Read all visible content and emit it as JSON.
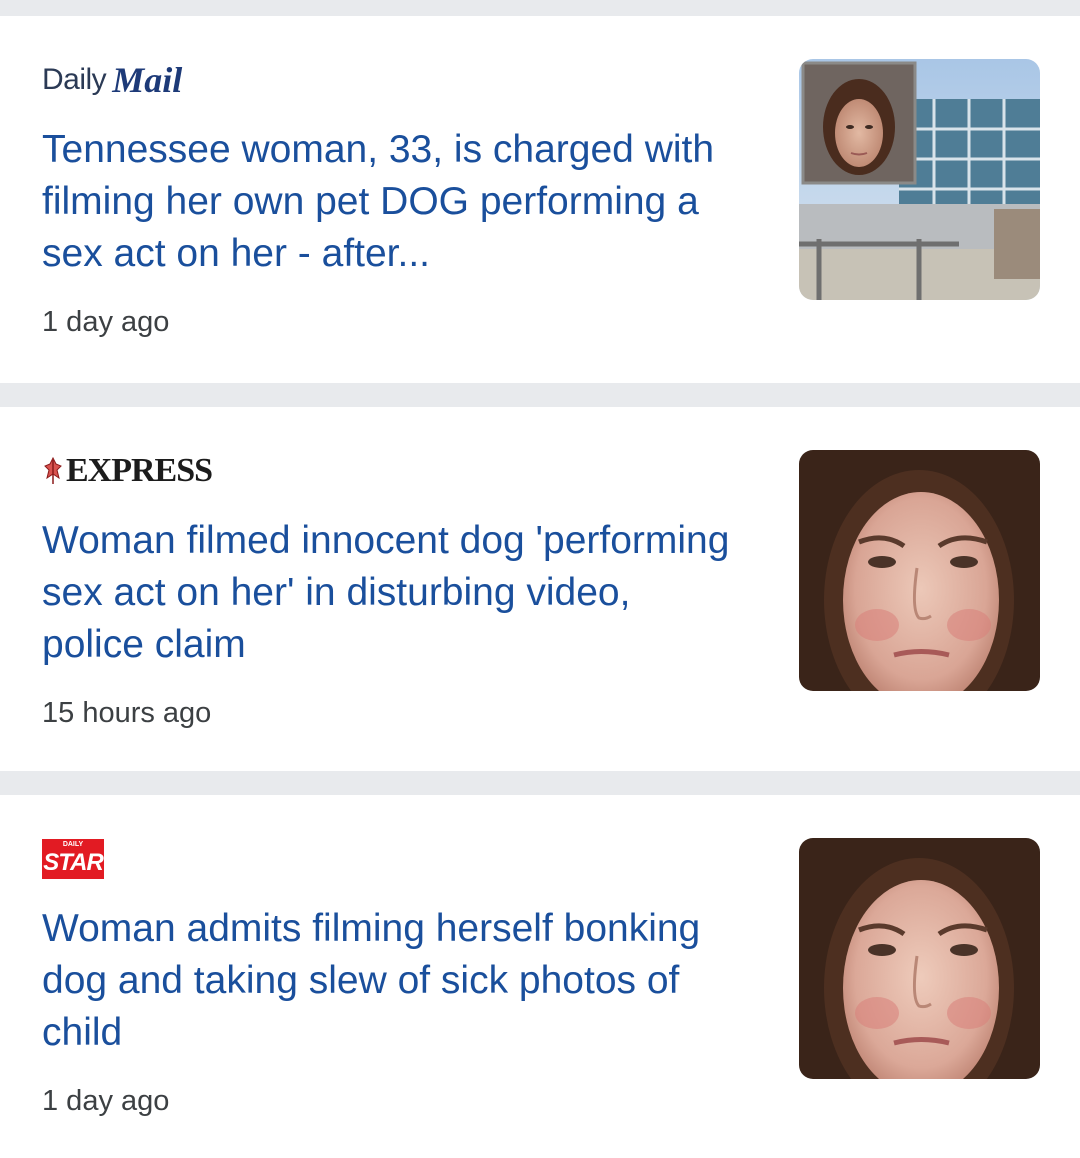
{
  "articles": [
    {
      "source_parts": [
        "Daily",
        "Mail"
      ],
      "headline": "Tennessee woman, 33, is charged with filming her own pet DOG performing a sex act on her - after...",
      "time": "1 day ago",
      "thumbnail_icon": "mugshot-courthouse-photo"
    },
    {
      "source_parts": [
        "EXPRESS"
      ],
      "headline": "Woman filmed innocent dog 'performing sex act on her' in disturbing video, police claim",
      "time": "15 hours ago",
      "thumbnail_icon": "mugshot-face-photo"
    },
    {
      "source_parts": [
        "DAILY",
        "STAR"
      ],
      "headline": "Woman admits filming herself bonking dog and taking slew of sick photos of child",
      "time": "1 day ago",
      "thumbnail_icon": "mugshot-face-photo"
    }
  ],
  "colors": {
    "headline": "#1a4f9c",
    "background": "#e8eaed",
    "star_red": "#e21b23"
  }
}
